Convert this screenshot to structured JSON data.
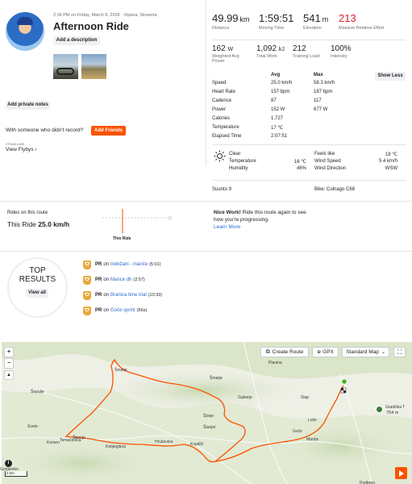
{
  "activity": {
    "datetime": "2:34 PM on Friday, March 6, 2026 · Vipava, Slovenia",
    "title": "Afternoon Ride",
    "add_description": "Add a description",
    "add_private_notes": "Add private notes",
    "someone_prompt": "With someone who didn't record?",
    "add_friends": "Add Friends",
    "flyby_small": "STRAVA LABS",
    "view_flybys": "View Flybys"
  },
  "stats": {
    "distance": {
      "value": "49.99",
      "unit": "km",
      "label": "Distance"
    },
    "moving_time": {
      "value": "1:59:51",
      "label": "Moving Time"
    },
    "elevation": {
      "value": "541",
      "unit": "m",
      "label": "Elevation"
    },
    "relative_effort": {
      "value": "213",
      "label": "Massive Relative Effort",
      "color": "#dd1d2c"
    },
    "weighted_power": {
      "value": "162",
      "unit": "W",
      "label": "Weighted Avg Power"
    },
    "total_work": {
      "value": "1,092",
      "unit": "kJ",
      "label": "Total Work"
    },
    "training_load": {
      "value": "212",
      "label": "Training Load"
    },
    "intensity": {
      "value": "100%",
      "label": "Intensity"
    }
  },
  "detail_table": {
    "col_avg": "Avg",
    "col_max": "Max",
    "show_less": "Show Less",
    "rows": [
      {
        "label": "Speed",
        "avg": "25.0 km/h",
        "max": "58.3 km/h"
      },
      {
        "label": "Heart Rate",
        "avg": "157 bpm",
        "max": "187 bpm"
      },
      {
        "label": "Cadence",
        "avg": "87",
        "max": "117"
      },
      {
        "label": "Power",
        "avg": "152 W",
        "max": "677 W"
      },
      {
        "label": "Calories",
        "avg": "1,727",
        "max": ""
      },
      {
        "label": "Temperature",
        "avg": "17 ℃",
        "max": ""
      },
      {
        "label": "Elapsed Time",
        "avg": "2:07:51",
        "max": ""
      }
    ]
  },
  "weather": {
    "condition": "Clear",
    "temperature_label": "Temperature",
    "temperature": "16 ℃",
    "humidity_label": "Humidity",
    "humidity": "46%",
    "feels_like_label": "Feels like",
    "feels_like": "18 ℃",
    "wind_speed_label": "Wind Speed",
    "wind_speed": "5.4 km/h",
    "wind_dir_label": "Wind Direction",
    "wind_dir": "WSW"
  },
  "device": "Suunto 9",
  "bike": "Bike: Colnago C68",
  "route": {
    "title": "Rides on this route",
    "this_ride_label": "This Ride",
    "this_ride_value": "25.0 km/h",
    "chart_label": "This Ride",
    "nice_work_bold": "Nice Work!",
    "nice_work_text": " Ride this route again to see how you're progressing.",
    "learn_more": "Learn More"
  },
  "top_results": {
    "title_line1": "TOP",
    "title_line2": "RESULTS",
    "view_all": "View all",
    "items": [
      {
        "pr": "PR",
        "on": "on",
        "segment": "trebižani - manče",
        "time": "(5:01)"
      },
      {
        "pr": "PR",
        "on": "on",
        "segment": "Mance dh",
        "time": "(2:57)"
      },
      {
        "pr": "PR",
        "on": "on",
        "segment": "Branica time trial",
        "time": "(10:33)"
      },
      {
        "pr": "PR",
        "on": "on",
        "segment": "Goče sprint",
        "time": "(56s)"
      }
    ]
  },
  "map": {
    "create_route": "Create Route",
    "gpx": "GPX",
    "map_style": "Standard Map",
    "zoom_in": "+",
    "zoom_out": "−",
    "scale": "2 km",
    "places": [
      {
        "name": "Planina"
      },
      {
        "name": "Šmarje"
      },
      {
        "name": "Gaberje"
      },
      {
        "name": "Slap"
      },
      {
        "name": "Štorje"
      },
      {
        "name": "Lože"
      },
      {
        "name": "Goče"
      },
      {
        "name": "Manče"
      },
      {
        "name": "Gradiška T"
      },
      {
        "name": "Šepulje"
      },
      {
        "name": "Šternje"
      },
      {
        "name": "Sveto"
      },
      {
        "name": "Komen"
      },
      {
        "name": "Tomačevica"
      },
      {
        "name": "Kobjeglava"
      },
      {
        "name": "Hruševica"
      },
      {
        "name": "Kopitiči"
      },
      {
        "name": "Šmarje"
      },
      {
        "name": "Podbreg"
      },
      {
        "name": "Štanjel"
      },
      {
        "name": "Gorjansko"
      }
    ],
    "peak_label": "754 m"
  }
}
